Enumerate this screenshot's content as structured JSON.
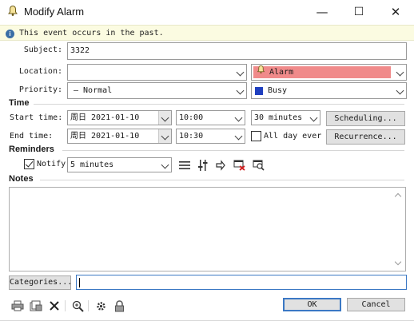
{
  "window": {
    "title": "Modify Alarm",
    "icon": "bell-icon",
    "minimize_glyph": "—",
    "maximize_glyph": "☐",
    "close_glyph": "✕"
  },
  "info": {
    "text": "This event occurs in the past.",
    "icon_glyph": "i"
  },
  "subject": {
    "label": "Subject:",
    "value": "3322"
  },
  "location": {
    "label": "Location:",
    "value": ""
  },
  "category_select": {
    "value": "Alarm",
    "color": "#f08a8a",
    "icon_glyph": "🔔"
  },
  "priority": {
    "label": "Priority:",
    "value": "— Normal"
  },
  "busy_select": {
    "value": "Busy",
    "color": "#1f3fbf"
  },
  "time": {
    "section_label": "Time",
    "start_label": "Start time:",
    "start_date": "周日 2021-01-10",
    "start_time": "10:00",
    "duration": "30 minutes",
    "scheduling_label": "Scheduling...",
    "end_label": "End time:",
    "end_date": "周日 2021-01-10",
    "end_time": "10:30",
    "all_day_label": "All day ever",
    "all_day_checked": false,
    "recurrence_label": "Recurrence..."
  },
  "reminders": {
    "section_label": "Reminders",
    "notify_label": "Notify",
    "notify_checked": true,
    "notify_value": "5 minutes",
    "tools": [
      "list-icon",
      "adjust-icon",
      "pin-icon",
      "delete-reminder-icon",
      "preview-icon"
    ]
  },
  "notes": {
    "section_label": "Notes",
    "value": ""
  },
  "categories": {
    "button_label": "Categories...",
    "value": ""
  },
  "toolbar": {
    "tools": [
      "print-icon",
      "print-preview-icon",
      "delete-icon",
      "zoom-icon",
      "settings-icon",
      "lock-icon"
    ],
    "ok_label": "OK",
    "cancel_label": "Cancel"
  }
}
